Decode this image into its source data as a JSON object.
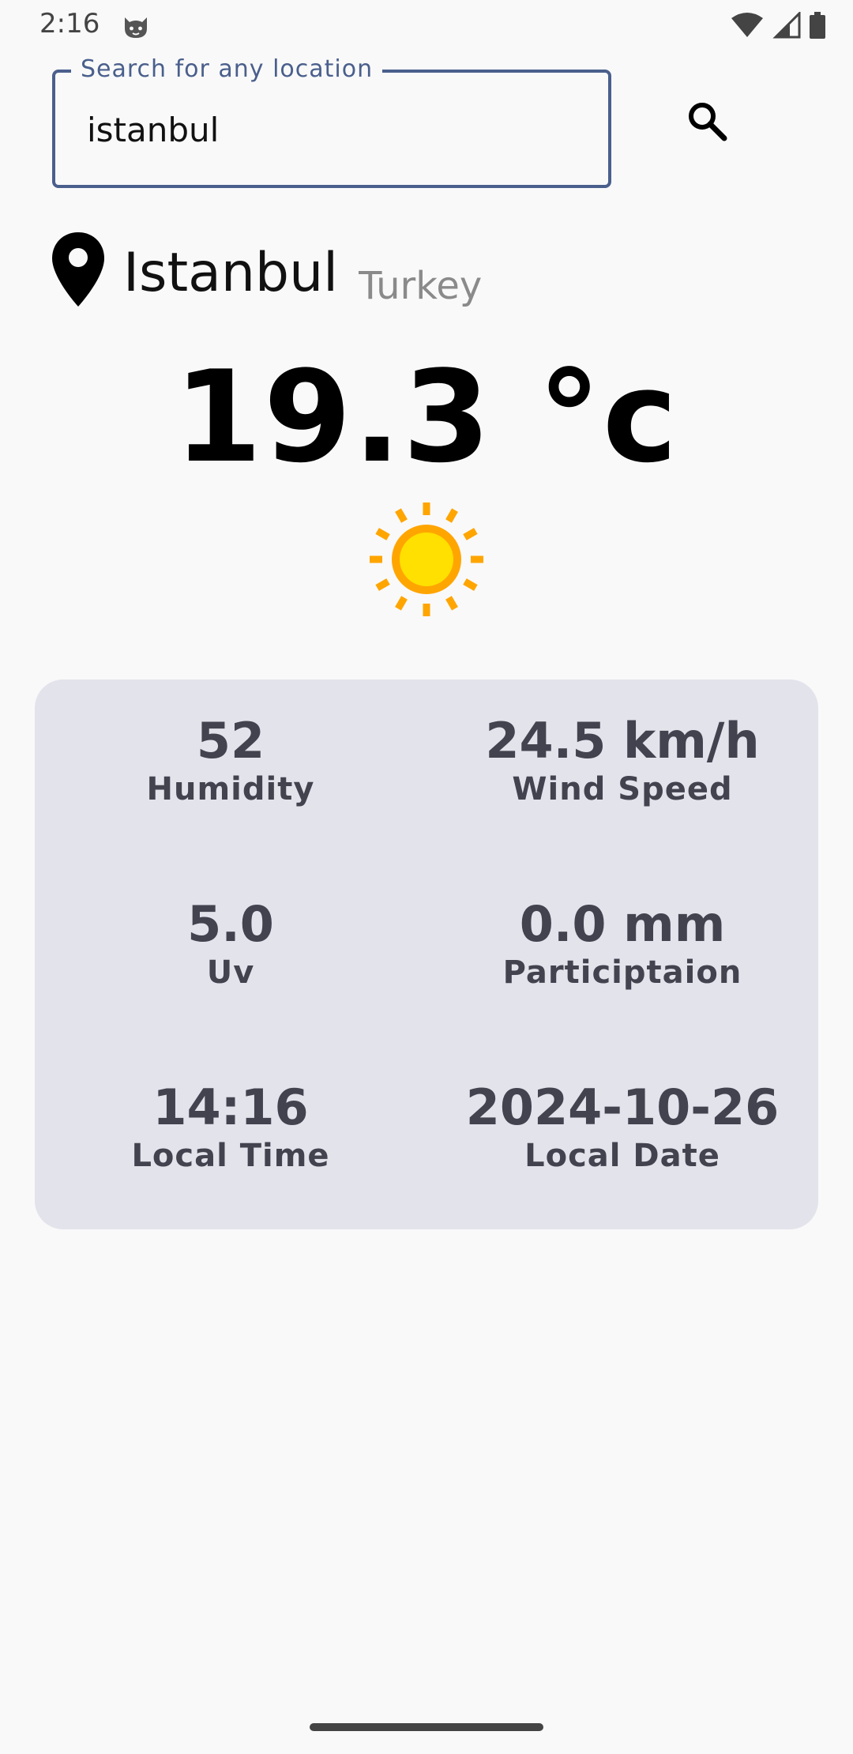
{
  "status_bar": {
    "time": "2:16",
    "icons": [
      "cat-face-icon",
      "wifi-icon",
      "signal-icon",
      "battery-icon"
    ]
  },
  "search": {
    "label": "Search for any location",
    "value": "istanbul",
    "button_icon": "search-icon"
  },
  "location": {
    "icon": "location-pin-icon",
    "city": "Istanbul",
    "country": "Turkey"
  },
  "weather": {
    "temperature": "19.3 °c",
    "condition_icon": "sun-icon"
  },
  "details": [
    {
      "value": "52",
      "label": "Humidity"
    },
    {
      "value": "24.5 km/h",
      "label": "Wind Speed"
    },
    {
      "value": "5.0",
      "label": "Uv"
    },
    {
      "value": "0.0 mm",
      "label": "Participtaion"
    },
    {
      "value": "14:16",
      "label": "Local Time"
    },
    {
      "value": "2024-10-26",
      "label": "Local Date"
    }
  ],
  "colors": {
    "accent": "#4a5f8c",
    "card_background": "#e3e3ec",
    "card_text": "#43434f",
    "sun_outer": "#ffa500",
    "sun_inner": "#ffe000"
  }
}
